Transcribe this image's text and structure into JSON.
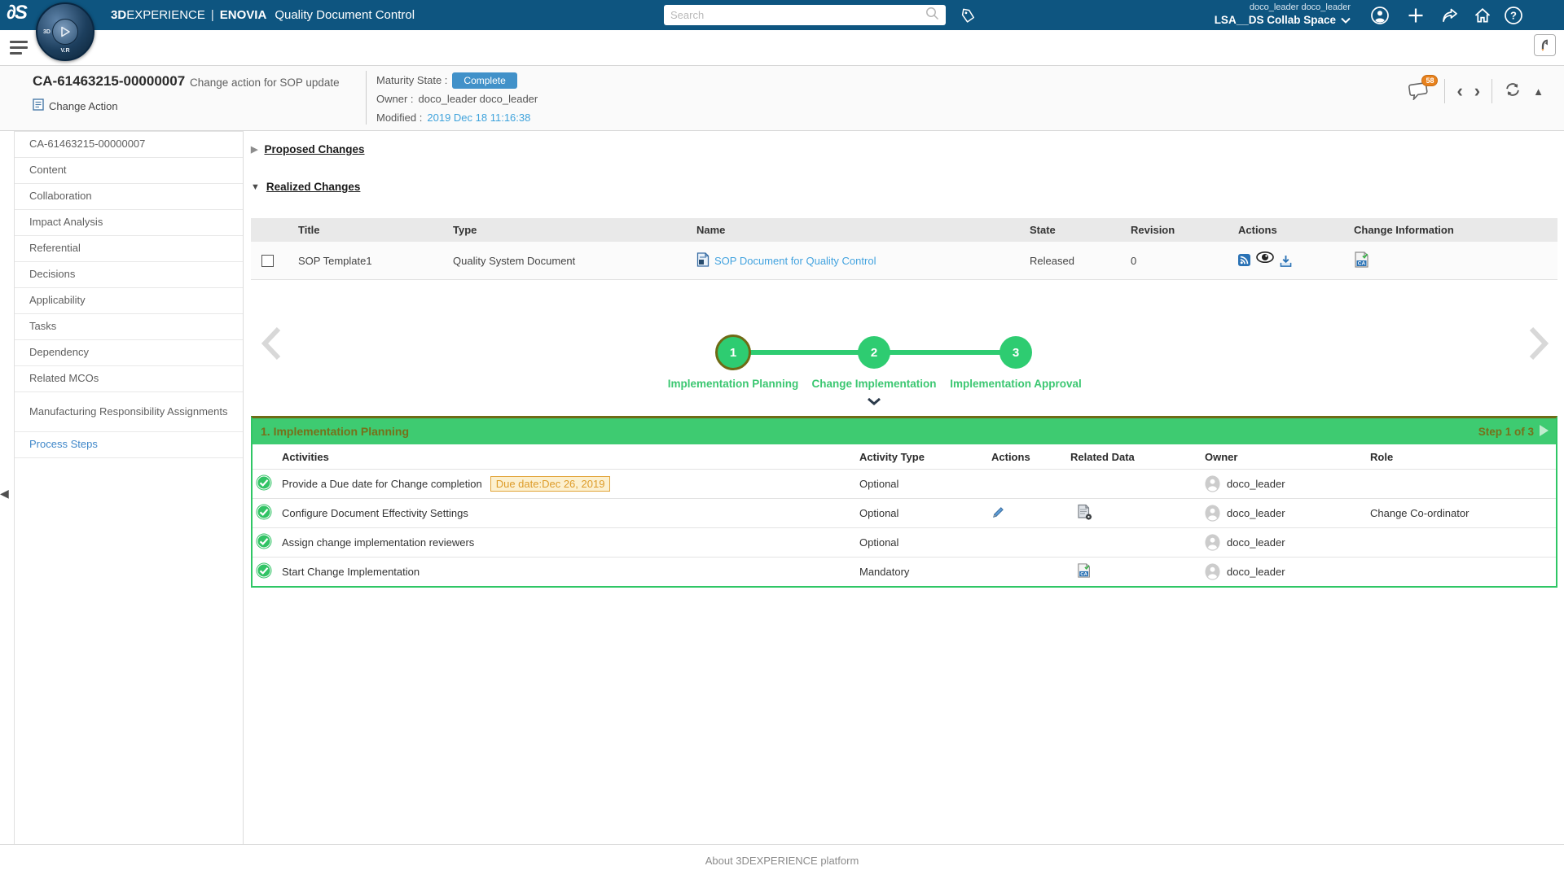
{
  "colors": {
    "header_blue": "#0e5580",
    "complete_button_blue": "#4191c9",
    "link_blue": "#43a3df",
    "green": "#3ecb71",
    "olive_text": "#77701a",
    "badge_orange": "#e8821e",
    "due_chip_bg": "#fcf0cf",
    "due_chip_border": "#e2a43a"
  },
  "icons": {
    "logo": "3ds-swoosh",
    "compass": "3dexperience-compass-play",
    "search": "magnifier",
    "tag": "tag-outline",
    "user": "person-circle",
    "add": "plus",
    "share": "share-arrow",
    "home": "house-outline",
    "help": "question-circle",
    "menu": "hamburger",
    "panel_toggle": "curled-arrow-box",
    "comments": "speech-bubble",
    "prev": "chevron-left",
    "next": "chevron-right",
    "refresh": "circular-arrow",
    "collapse": "triangle-up",
    "subscribe": "rss-square",
    "preview": "eye",
    "download": "download-tray",
    "change_info": "ca-document-check",
    "edit": "pencil",
    "related": "document-gear",
    "done": "green-check-circle",
    "owner": "person-avatar"
  },
  "header": {
    "brand_bold": "3D",
    "brand_rest": "EXPERIENCE",
    "brand_divider": "|",
    "brand_app": "ENOVIA",
    "brand_product": "Quality Document Control",
    "search_placeholder": "Search",
    "user_line1": "doco_leader doco_leader",
    "user_line2": "LSA__DS Collab Space",
    "compass_left": "3D",
    "compass_bottom": "V.R"
  },
  "context": {
    "id": "CA-61463215-00000007",
    "description": "Change action for SOP update",
    "type": "Change Action",
    "maturity_label": "Maturity State :",
    "maturity_value": "Complete",
    "owner_label": "Owner :",
    "owner_value": "doco_leader doco_leader",
    "modified_label": "Modified :",
    "modified_value": "2019 Dec 18 11:16:38",
    "comments_badge": "58"
  },
  "sidebar": {
    "items": [
      "CA-61463215-00000007",
      "Content",
      "Collaboration",
      "Impact Analysis",
      "Referential",
      "Decisions",
      "Applicability",
      "Tasks",
      "Dependency",
      "Related MCOs",
      "Manufacturing Responsibility Assignments",
      "Process Steps"
    ]
  },
  "main": {
    "proposed_title": "Proposed Changes",
    "realized_title": "Realized Changes",
    "realized_table": {
      "headers": {
        "title": "Title",
        "type": "Type",
        "name": "Name",
        "state": "State",
        "revision": "Revision",
        "actions": "Actions",
        "change_info": "Change Information"
      },
      "row": {
        "title": "SOP Template1",
        "type": "Quality System Document",
        "name": "SOP Document for Quality Control",
        "state": "Released",
        "revision": "0"
      }
    },
    "wizard": {
      "steps": [
        {
          "num": "1",
          "label": "Implementation Planning"
        },
        {
          "num": "2",
          "label": "Change Implementation"
        },
        {
          "num": "3",
          "label": "Implementation Approval"
        }
      ]
    },
    "step_panel": {
      "title": "1. Implementation Planning",
      "step_indicator": "Step 1 of 3",
      "headers": {
        "activities": "Activities",
        "activity_type": "Activity Type",
        "actions": "Actions",
        "related_data": "Related Data",
        "owner": "Owner",
        "role": "Role"
      },
      "rows": [
        {
          "activity": "Provide a Due date for Change completion",
          "due_date": "Due date:Dec 26, 2019",
          "activity_type": "Optional",
          "owner": "doco_leader",
          "role": ""
        },
        {
          "activity": "Configure Document Effectivity Settings",
          "activity_type": "Optional",
          "owner": "doco_leader",
          "role": "Change Co-ordinator"
        },
        {
          "activity": "Assign change implementation reviewers",
          "activity_type": "Optional",
          "owner": "doco_leader",
          "role": ""
        },
        {
          "activity": "Start Change Implementation",
          "activity_type": "Mandatory",
          "owner": "doco_leader",
          "role": ""
        }
      ]
    }
  },
  "footer": {
    "about": "About 3DEXPERIENCE platform"
  }
}
